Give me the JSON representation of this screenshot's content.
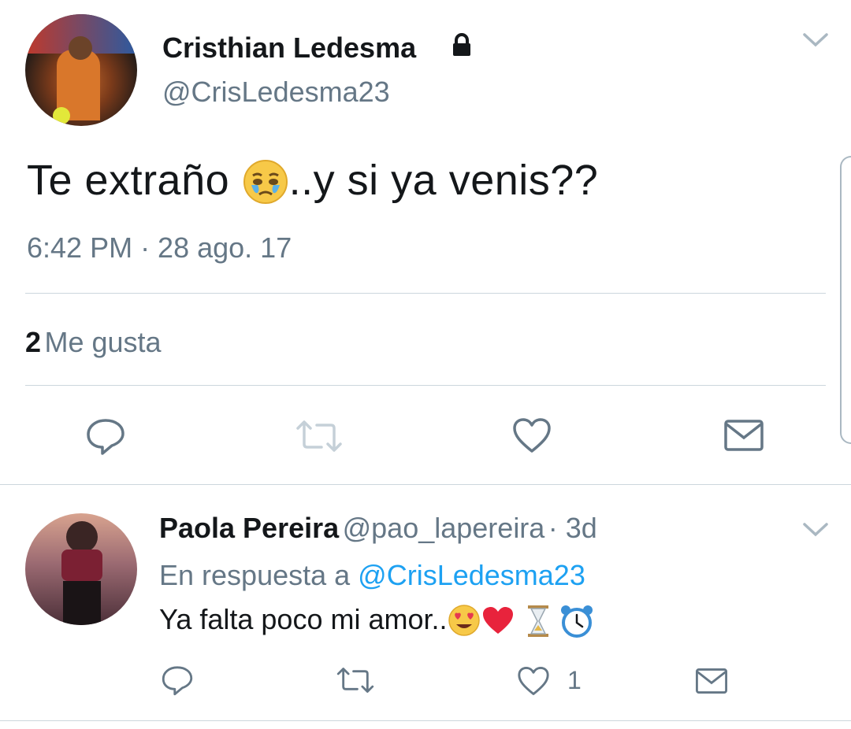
{
  "tweet": {
    "author_name": "Cristhian Ledesma",
    "author_handle": "@CrisLedesma23",
    "text_before": "Te extraño ",
    "text_after": "..y si ya venis??",
    "emoji_icon": "crying-face-icon",
    "timestamp": "6:42 PM · 28 ago. 17",
    "likes_count": "2",
    "likes_label": "Me gusta",
    "protected_icon": "lock-icon"
  },
  "reply": {
    "author_name": "Paola Pereira",
    "author_handle": "@pao_lapereira",
    "time": "· 3d",
    "in_reply_prefix": "En respuesta a",
    "in_reply_mention": "@CrisLedesma23",
    "text": "Ya falta poco mi amor..",
    "emoji_icons": [
      "heart-eyes-icon",
      "red-heart-icon",
      "hourglass-icon",
      "alarm-clock-icon"
    ],
    "likes_count": "1"
  },
  "colors": {
    "text": "#14171a",
    "secondary": "#657786",
    "link": "#1da1f2",
    "divider": "#ccd6dd",
    "icon": "#657786"
  }
}
